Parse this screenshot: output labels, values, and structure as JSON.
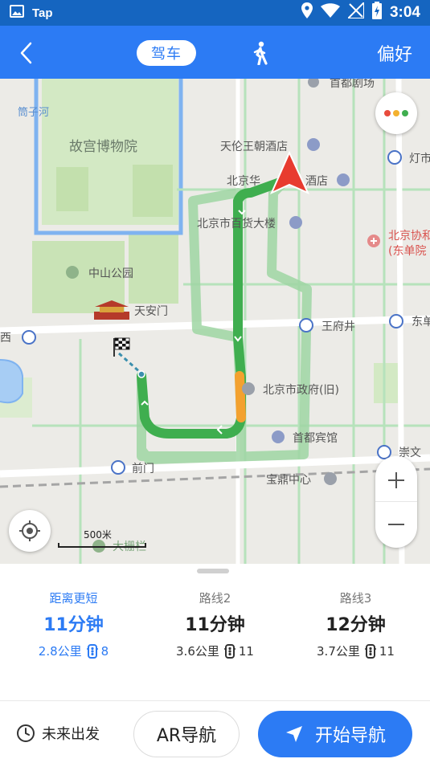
{
  "status_bar": {
    "app_label": "Tap",
    "time": "3:04"
  },
  "header": {
    "mode_drive_label": "驾车",
    "preferences_label": "偏好"
  },
  "map": {
    "labels": {
      "shoudu_theater": "首都剧场",
      "tianlun_hotel": "天伦王朝酒店",
      "huaqiao_hotel_prefix": "北京华",
      "huaqiao_hotel_suffix": "酒店",
      "department_store": "北京市百货大楼",
      "xiehe_1": "北京协和",
      "xiehe_2": "(东单院",
      "forbidden_city": "故宫博物院",
      "nanchizi": "筒子河",
      "zhongshan_park": "中山公园",
      "tiananmen": "天安门",
      "wangfujing": "王府井",
      "dongdan": "东单",
      "xidan_fragment": "西",
      "dengshi_fragment": "灯市",
      "govt": "北京市政府(旧)",
      "capital_hotel": "首都宾馆",
      "qianmen": "前门",
      "baoding": "宝鼎中心",
      "chongwen": "崇文",
      "dashilan": "大栅栏"
    },
    "scale_label": "500米",
    "colors": {
      "route_main": "#3fae4f",
      "route_alt": "#9fd6a4",
      "route_slow": "#f3a12f",
      "road": "#ffffff",
      "road_minor": "#b6e2bb",
      "park": "#c9e3b6",
      "moat": "#7fb3f0",
      "marker": "#e83b2f"
    }
  },
  "routes": [
    {
      "tag": "距离更短",
      "time": "11分钟",
      "distance": "2.8公里",
      "traffic_lights": "8",
      "active": true
    },
    {
      "tag": "路线2",
      "time": "11分钟",
      "distance": "3.6公里",
      "traffic_lights": "11",
      "active": false
    },
    {
      "tag": "路线3",
      "time": "12分钟",
      "distance": "3.7公里",
      "traffic_lights": "11",
      "active": false
    }
  ],
  "actions": {
    "future_depart": "未来出发",
    "ar_nav": "AR导航",
    "start_nav": "开始导航"
  }
}
